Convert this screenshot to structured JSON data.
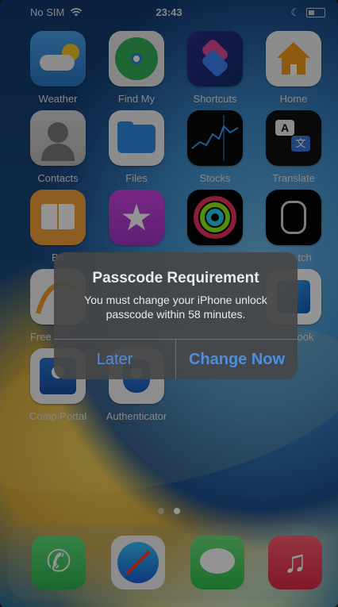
{
  "status_bar": {
    "carrier": "No SIM",
    "time": "23:43"
  },
  "apps": [
    {
      "name": "Weather",
      "icon": "weather-icon",
      "color": "#58a9e9"
    },
    {
      "name": "Find My",
      "icon": "find-my-icon",
      "color": "#2e9e55"
    },
    {
      "name": "Shortcuts",
      "icon": "shortcuts-icon",
      "color": "#3d3cc4"
    },
    {
      "name": "Home",
      "icon": "home-icon",
      "color": "#ffffff"
    },
    {
      "name": "Contacts",
      "icon": "contacts-icon",
      "color": "#bfbfbf"
    },
    {
      "name": "Files",
      "icon": "files-icon",
      "color": "#ffffff"
    },
    {
      "name": "Stocks",
      "icon": "stocks-icon",
      "color": "#000000"
    },
    {
      "name": "Translate",
      "icon": "translate-icon",
      "color": "#0a0a0a"
    },
    {
      "name": "Books",
      "icon": "books-icon",
      "color": "#f79b2a"
    },
    {
      "name": "iTunes Store",
      "icon": "itunes-star-icon",
      "color": "#c541d8"
    },
    {
      "name": "Fitness",
      "icon": "fitness-rings-icon",
      "color": "#000000"
    },
    {
      "name": "Watch",
      "icon": "watch-icon",
      "color": "#000000"
    },
    {
      "name": "Freeform",
      "icon": "freeform-icon",
      "color": "#f2f2f2"
    },
    {
      "name": "Outlook",
      "icon": "outlook-icon",
      "color": "#ffffff"
    },
    {
      "name": "Comp Portal",
      "icon": "company-portal-icon",
      "color": "#ffffff"
    },
    {
      "name": "Authenticator",
      "icon": "authenticator-icon",
      "color": "#ffffff"
    }
  ],
  "visible_labels": {
    "weather": "Weather",
    "find_my": "Find My",
    "shortcuts": "Shortcuts",
    "home": "Home",
    "contacts": "Contacts",
    "files": "Files",
    "stocks": "Stocks",
    "translate": "Translate",
    "books_partial": "Bo",
    "watch_partial": "tch",
    "freeform_partial": "Free",
    "outlook_partial": "ook",
    "comp_portal": "Comp Portal",
    "authenticator": "Authenticator"
  },
  "dock": [
    {
      "name": "Phone",
      "icon": "phone-icon",
      "color": "#3fc65f"
    },
    {
      "name": "Safari",
      "icon": "safari-icon",
      "color": "#f0f0f0"
    },
    {
      "name": "Messages",
      "icon": "messages-icon",
      "color": "#43c65a"
    },
    {
      "name": "Music",
      "icon": "music-icon",
      "color": "#f0445a"
    }
  ],
  "page_indicator": {
    "pages": 2,
    "current": 2
  },
  "alert": {
    "title": "Passcode Requirement",
    "message": "You must change your iPhone unlock passcode within 58 minutes.",
    "buttons": {
      "later": "Later",
      "change_now": "Change Now"
    },
    "accent": "#4c8fe0"
  }
}
